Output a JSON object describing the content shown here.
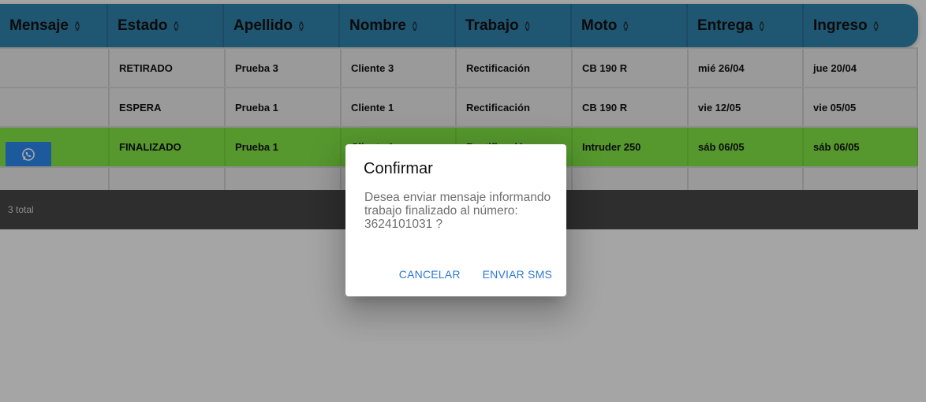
{
  "table": {
    "columns": [
      {
        "label": "Mensaje",
        "sort": true
      },
      {
        "label": "Estado",
        "sort": true
      },
      {
        "label": "Apellido",
        "sort": true
      },
      {
        "label": "Nombre",
        "sort": true
      },
      {
        "label": "Trabajo",
        "sort": true
      },
      {
        "label": "Moto",
        "sort": true
      },
      {
        "label": "Entrega",
        "sort": true
      },
      {
        "label": "Ingreso",
        "sort": true
      }
    ],
    "rows": [
      {
        "estado": "RETIRADO",
        "apellido": "Prueba 3",
        "nombre": "Cliente 3",
        "trabajo": "Rectificación",
        "moto": "CB 190 R",
        "entrega": "mié 26/04",
        "ingreso": "jue 20/04",
        "highlight": false,
        "whatsapp": false
      },
      {
        "estado": "ESPERA",
        "apellido": "Prueba 1",
        "nombre": "Cliente 1",
        "trabajo": "Rectificación",
        "moto": "CB 190 R",
        "entrega": "vie 12/05",
        "ingreso": "vie 05/05",
        "highlight": false,
        "whatsapp": false
      },
      {
        "estado": "FINALIZADO",
        "apellido": "Prueba 1",
        "nombre": "Cliente 1",
        "trabajo": "Rectificación",
        "moto": "Intruder 250",
        "entrega": "sáb 06/05",
        "ingreso": "sáb 06/05",
        "highlight": true,
        "whatsapp": true
      }
    ],
    "footer_total": "3 total"
  },
  "icons": {
    "whatsapp_button": "whatsapp-icon",
    "sort": "sort-arrows-icon"
  },
  "dialog": {
    "title": "Confirmar",
    "message": "Desea enviar mensaje informando trabajo finalizado al número: 3624101031 ?",
    "cancel_label": "CANCELAR",
    "confirm_label": "ENVIAR SMS"
  },
  "colors": {
    "header_bg": "#2f7fa7",
    "highlight_row": "#7fe044",
    "whatsapp_button": "#2c84e8",
    "dialog_action": "#2f78d3",
    "footer_bg": "#444444"
  }
}
